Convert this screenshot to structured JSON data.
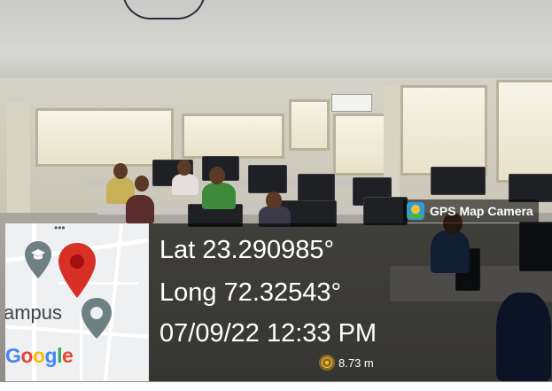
{
  "app": {
    "badge_label": "GPS Map Camera",
    "badge_icon": "gps-map-camera-logo-icon"
  },
  "map": {
    "label": "ampus",
    "attribution": "Google",
    "icons": [
      "graduation-cap-pin-icon",
      "location-pin-icon",
      "gray-place-pin-icon"
    ],
    "colors": {
      "pin": "#d93025",
      "gray_pin": "#6f8082",
      "g_blue": "#4285f4",
      "g_red": "#ea4335",
      "g_yellow": "#fbbc05",
      "g_green": "#34a853"
    }
  },
  "geo": {
    "lat": "Lat 23.290985°",
    "long": "Long 72.32543°",
    "datetime": "07/09/22 12:33 PM",
    "accuracy": "8.73 m",
    "accuracy_icon": "accuracy-target-icon"
  }
}
